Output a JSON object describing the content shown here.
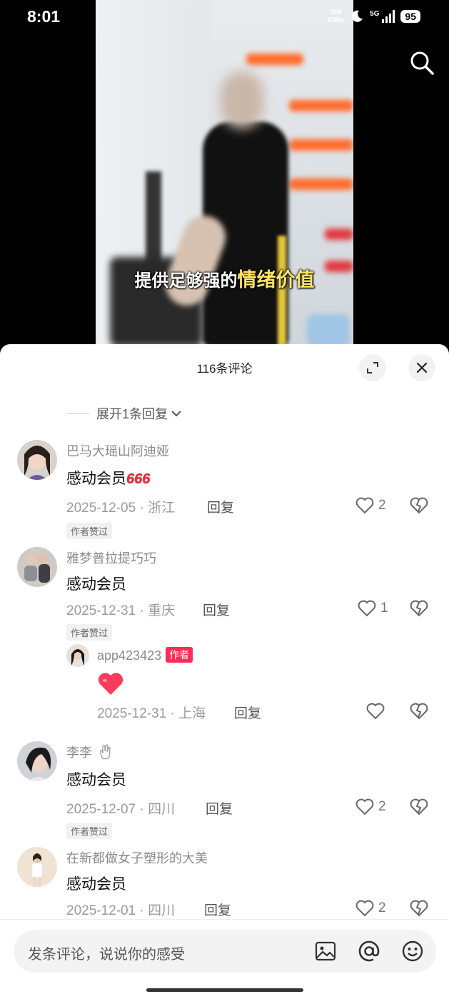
{
  "status": {
    "time": "8:01",
    "net_speed_value": "350",
    "net_speed_unit": "KB/s",
    "network": "5G",
    "battery": "95"
  },
  "video": {
    "subtitle_main": "提供足够强的",
    "subtitle_highlight": "情绪价值"
  },
  "comments_panel": {
    "count_label": "116条评论",
    "expand_replies_label": "展开1条回复",
    "comments": [
      {
        "username": "巴马大瑶山阿迪娅",
        "text": "感动会员",
        "emoji": "666",
        "date": "2025-12-05",
        "location": "浙江",
        "reply_label": "回复",
        "likes": "2",
        "badge": "作者赞过"
      },
      {
        "username": "雅梦普拉提巧巧",
        "text": "感动会员",
        "date": "2025-12-31",
        "location": "重庆",
        "reply_label": "回复",
        "likes": "1",
        "badge": "作者赞过",
        "reply": {
          "username": "app423423",
          "author_tag": "作者",
          "content_emoji": "heart",
          "date": "2025-12-31",
          "location": "上海",
          "reply_label": "回复"
        }
      },
      {
        "username": "李李",
        "text": "感动会员",
        "date": "2025-12-07",
        "location": "四川",
        "reply_label": "回复",
        "likes": "2",
        "badge": "作者赞过"
      },
      {
        "username": "在新都做女子塑形的大美",
        "text": "感动会员",
        "date": "2025-12-01",
        "location": "四川",
        "reply_label": "回复",
        "likes": "2"
      }
    ],
    "input_placeholder": "发条评论，说说你的感受"
  },
  "colors": {
    "accent": "#fe2c55",
    "heart_red": "#ff3b5c",
    "emoji_666": "#e8283c"
  },
  "icons": [
    "search-icon",
    "expand-icon",
    "close-icon",
    "chevron-down-icon",
    "heart-icon",
    "dislike-icon",
    "image-icon",
    "at-icon",
    "emoji-icon"
  ]
}
